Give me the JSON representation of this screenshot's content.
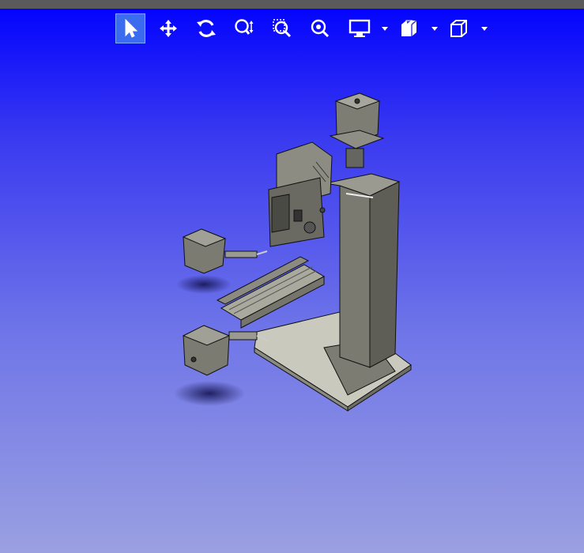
{
  "toolbar": {
    "tools": [
      {
        "name": "select-tool",
        "icon": "arrow-pointer-icon",
        "active": true
      },
      {
        "name": "pan-tool",
        "icon": "move-arrows-icon",
        "active": false
      },
      {
        "name": "rotate-tool",
        "icon": "rotate-icon",
        "active": false
      },
      {
        "name": "zoom-tool",
        "icon": "zoom-icon",
        "active": false
      },
      {
        "name": "zoom-window-tool",
        "icon": "zoom-window-icon",
        "active": false
      },
      {
        "name": "zoom-fit-tool",
        "icon": "zoom-fit-icon",
        "active": false
      },
      {
        "name": "display-mode-dropdown",
        "icon": "monitor-icon",
        "has_dropdown": true
      },
      {
        "name": "section-view-dropdown",
        "icon": "section-view-icon",
        "has_dropdown": true
      },
      {
        "name": "view-orientation-dropdown",
        "icon": "cube-icon",
        "has_dropdown": true
      }
    ]
  },
  "viewport": {
    "background_top": "#0000ff",
    "background_bottom": "#9aa0e0",
    "model": "cnc-milling-machine"
  },
  "colors": {
    "accent": "#3b6cf0",
    "topbar": "#5a5a5a",
    "model_body": "#6e6e66",
    "model_light": "#c9c9bd"
  }
}
